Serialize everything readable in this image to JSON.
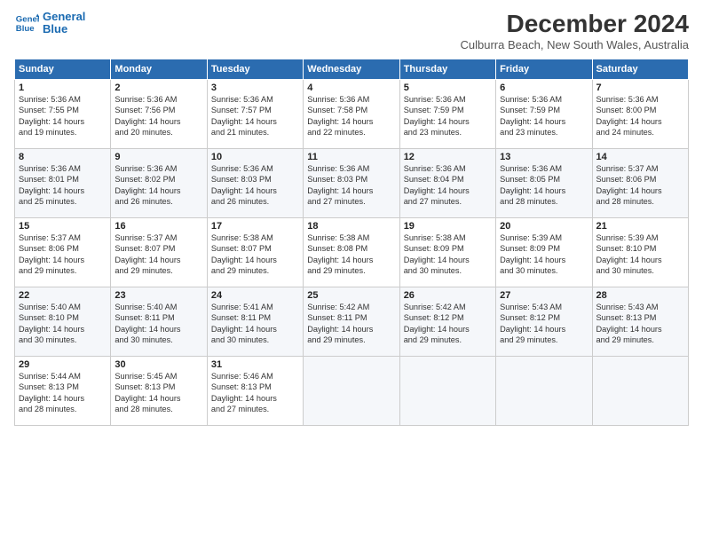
{
  "logo": {
    "line1": "General",
    "line2": "Blue"
  },
  "title": "December 2024",
  "subtitle": "Culburra Beach, New South Wales, Australia",
  "headers": [
    "Sunday",
    "Monday",
    "Tuesday",
    "Wednesday",
    "Thursday",
    "Friday",
    "Saturday"
  ],
  "weeks": [
    [
      {
        "day": "1",
        "info": "Sunrise: 5:36 AM\nSunset: 7:55 PM\nDaylight: 14 hours\nand 19 minutes."
      },
      {
        "day": "2",
        "info": "Sunrise: 5:36 AM\nSunset: 7:56 PM\nDaylight: 14 hours\nand 20 minutes."
      },
      {
        "day": "3",
        "info": "Sunrise: 5:36 AM\nSunset: 7:57 PM\nDaylight: 14 hours\nand 21 minutes."
      },
      {
        "day": "4",
        "info": "Sunrise: 5:36 AM\nSunset: 7:58 PM\nDaylight: 14 hours\nand 22 minutes."
      },
      {
        "day": "5",
        "info": "Sunrise: 5:36 AM\nSunset: 7:59 PM\nDaylight: 14 hours\nand 23 minutes."
      },
      {
        "day": "6",
        "info": "Sunrise: 5:36 AM\nSunset: 7:59 PM\nDaylight: 14 hours\nand 23 minutes."
      },
      {
        "day": "7",
        "info": "Sunrise: 5:36 AM\nSunset: 8:00 PM\nDaylight: 14 hours\nand 24 minutes."
      }
    ],
    [
      {
        "day": "8",
        "info": "Sunrise: 5:36 AM\nSunset: 8:01 PM\nDaylight: 14 hours\nand 25 minutes."
      },
      {
        "day": "9",
        "info": "Sunrise: 5:36 AM\nSunset: 8:02 PM\nDaylight: 14 hours\nand 26 minutes."
      },
      {
        "day": "10",
        "info": "Sunrise: 5:36 AM\nSunset: 8:03 PM\nDaylight: 14 hours\nand 26 minutes."
      },
      {
        "day": "11",
        "info": "Sunrise: 5:36 AM\nSunset: 8:03 PM\nDaylight: 14 hours\nand 27 minutes."
      },
      {
        "day": "12",
        "info": "Sunrise: 5:36 AM\nSunset: 8:04 PM\nDaylight: 14 hours\nand 27 minutes."
      },
      {
        "day": "13",
        "info": "Sunrise: 5:36 AM\nSunset: 8:05 PM\nDaylight: 14 hours\nand 28 minutes."
      },
      {
        "day": "14",
        "info": "Sunrise: 5:37 AM\nSunset: 8:06 PM\nDaylight: 14 hours\nand 28 minutes."
      }
    ],
    [
      {
        "day": "15",
        "info": "Sunrise: 5:37 AM\nSunset: 8:06 PM\nDaylight: 14 hours\nand 29 minutes."
      },
      {
        "day": "16",
        "info": "Sunrise: 5:37 AM\nSunset: 8:07 PM\nDaylight: 14 hours\nand 29 minutes."
      },
      {
        "day": "17",
        "info": "Sunrise: 5:38 AM\nSunset: 8:07 PM\nDaylight: 14 hours\nand 29 minutes."
      },
      {
        "day": "18",
        "info": "Sunrise: 5:38 AM\nSunset: 8:08 PM\nDaylight: 14 hours\nand 29 minutes."
      },
      {
        "day": "19",
        "info": "Sunrise: 5:38 AM\nSunset: 8:09 PM\nDaylight: 14 hours\nand 30 minutes."
      },
      {
        "day": "20",
        "info": "Sunrise: 5:39 AM\nSunset: 8:09 PM\nDaylight: 14 hours\nand 30 minutes."
      },
      {
        "day": "21",
        "info": "Sunrise: 5:39 AM\nSunset: 8:10 PM\nDaylight: 14 hours\nand 30 minutes."
      }
    ],
    [
      {
        "day": "22",
        "info": "Sunrise: 5:40 AM\nSunset: 8:10 PM\nDaylight: 14 hours\nand 30 minutes."
      },
      {
        "day": "23",
        "info": "Sunrise: 5:40 AM\nSunset: 8:11 PM\nDaylight: 14 hours\nand 30 minutes."
      },
      {
        "day": "24",
        "info": "Sunrise: 5:41 AM\nSunset: 8:11 PM\nDaylight: 14 hours\nand 30 minutes."
      },
      {
        "day": "25",
        "info": "Sunrise: 5:42 AM\nSunset: 8:11 PM\nDaylight: 14 hours\nand 29 minutes."
      },
      {
        "day": "26",
        "info": "Sunrise: 5:42 AM\nSunset: 8:12 PM\nDaylight: 14 hours\nand 29 minutes."
      },
      {
        "day": "27",
        "info": "Sunrise: 5:43 AM\nSunset: 8:12 PM\nDaylight: 14 hours\nand 29 minutes."
      },
      {
        "day": "28",
        "info": "Sunrise: 5:43 AM\nSunset: 8:13 PM\nDaylight: 14 hours\nand 29 minutes."
      }
    ],
    [
      {
        "day": "29",
        "info": "Sunrise: 5:44 AM\nSunset: 8:13 PM\nDaylight: 14 hours\nand 28 minutes."
      },
      {
        "day": "30",
        "info": "Sunrise: 5:45 AM\nSunset: 8:13 PM\nDaylight: 14 hours\nand 28 minutes."
      },
      {
        "day": "31",
        "info": "Sunrise: 5:46 AM\nSunset: 8:13 PM\nDaylight: 14 hours\nand 27 minutes."
      },
      null,
      null,
      null,
      null
    ]
  ]
}
